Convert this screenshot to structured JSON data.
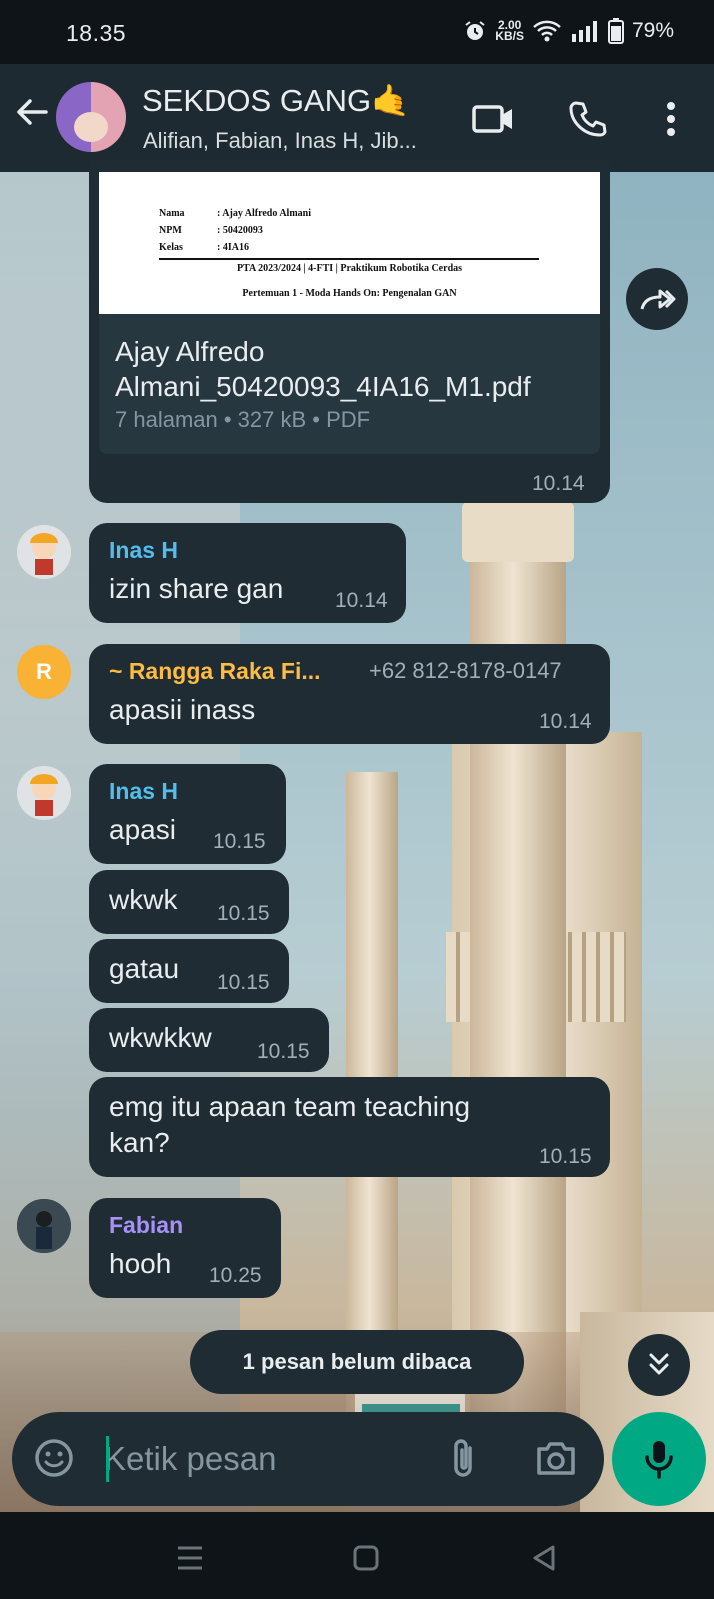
{
  "status_bar": {
    "time": "18.35",
    "speed_value": "2.00",
    "speed_unit": "KB/S",
    "battery": "79%"
  },
  "header": {
    "title": "SEKDOS GANG🤙",
    "members": "Alifian, Fabian, Inas H, Jib..."
  },
  "document": {
    "preview": {
      "nama_label": "Nama",
      "nama_value": ": Ajay Alfredo Almani",
      "npm_label": "NPM",
      "npm_value": ": 50420093",
      "kelas_label": "Kelas",
      "kelas_value": ": 4IA16",
      "title_line": "PTA 2023/2024 | 4-FTI | Praktikum Robotika Cerdas",
      "subtitle_line": "Pertemuan 1 - Moda Hands On: Pengenalan GAN"
    },
    "filename": "Ajay Alfredo Almani_50420093_4IA16_M1.pdf",
    "meta": "7 halaman • 327 kB • PDF",
    "time": "10.14"
  },
  "messages": [
    {
      "sender": "Inas H",
      "sender_color": "#53bdeb",
      "text": "izin share gan",
      "time": "10.14"
    },
    {
      "sender": "~ Rangga Raka Fi...",
      "sender_color": "#ffbc40",
      "phone": "+62 812-8178-0147",
      "avatar_letter": "R",
      "text": "apasii inass",
      "time": "10.14"
    },
    {
      "sender": "Inas H",
      "sender_color": "#53bdeb",
      "text": "apasi",
      "time": "10.15"
    },
    {
      "text": "wkwk",
      "time": "10.15"
    },
    {
      "text": "gatau",
      "time": "10.15"
    },
    {
      "text": "wkwkkw",
      "time": "10.15"
    },
    {
      "text": "emg itu apaan team teaching kan?",
      "time": "10.15"
    },
    {
      "sender": "Fabian",
      "sender_color": "#a791f6",
      "text": "hooh",
      "time": "10.25"
    }
  ],
  "unread_banner": "1 pesan belum dibaca",
  "composer": {
    "placeholder": "Ketik pesan"
  },
  "colors": {
    "accent": "#00a884",
    "bubble": "#1f2c34",
    "header": "#1e2a31"
  }
}
